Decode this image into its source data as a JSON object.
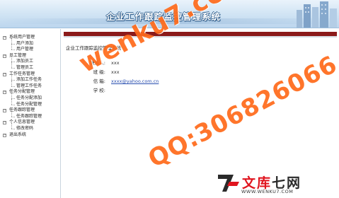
{
  "header": {
    "title": "企业工作跟踪监控管理系统"
  },
  "sidebar": {
    "tree": [
      {
        "type": "top",
        "label": "系统用户管理"
      },
      {
        "type": "sub",
        "label": "用户添加"
      },
      {
        "type": "sub",
        "label": "用户管理"
      },
      {
        "type": "top",
        "label": "员工管理"
      },
      {
        "type": "sub",
        "label": "添加员工"
      },
      {
        "type": "sub",
        "label": "管理员工"
      },
      {
        "type": "top",
        "label": "工作任务管理"
      },
      {
        "type": "sub",
        "label": "添加工作任务"
      },
      {
        "type": "sub",
        "label": "管理工作任务"
      },
      {
        "type": "top",
        "label": "任务分配管理"
      },
      {
        "type": "sub",
        "label": "任务分配添加"
      },
      {
        "type": "sub",
        "label": "任务分配管理"
      },
      {
        "type": "top",
        "label": "任务跟踪管理"
      },
      {
        "type": "sub",
        "label": "任务跟踪管理"
      },
      {
        "type": "top",
        "label": "个人信息管理"
      },
      {
        "type": "sub",
        "label": "修改密码"
      },
      {
        "type": "top",
        "label": "退出系统"
      }
    ]
  },
  "main": {
    "system_label": "企业工作跟踪监控管理系统",
    "info": [
      {
        "label": "联系人:",
        "value": "xxx",
        "is_link": false
      },
      {
        "label": "班 级:",
        "value": "xxx",
        "is_link": false
      },
      {
        "label": "信 箱:",
        "value": "xxxx@yahoo.com.cn",
        "is_link": true
      },
      {
        "label": "学 校:",
        "value": "",
        "is_link": false
      }
    ]
  },
  "overlay": {
    "watermark_site": "wenku7.com",
    "watermark_qq": "QQ:306826066",
    "brand_accent": "文库",
    "brand_rest": "七网",
    "brand_url": "WWW.WENKU7.COM"
  },
  "colors": {
    "header_light": "#eaf3fb",
    "header_dark": "#bcd6ee",
    "accent_bar": "#8b1a1a",
    "watermark": "#ff6a1a",
    "link": "#2a4fb0",
    "brand_red": "#e0141e"
  }
}
